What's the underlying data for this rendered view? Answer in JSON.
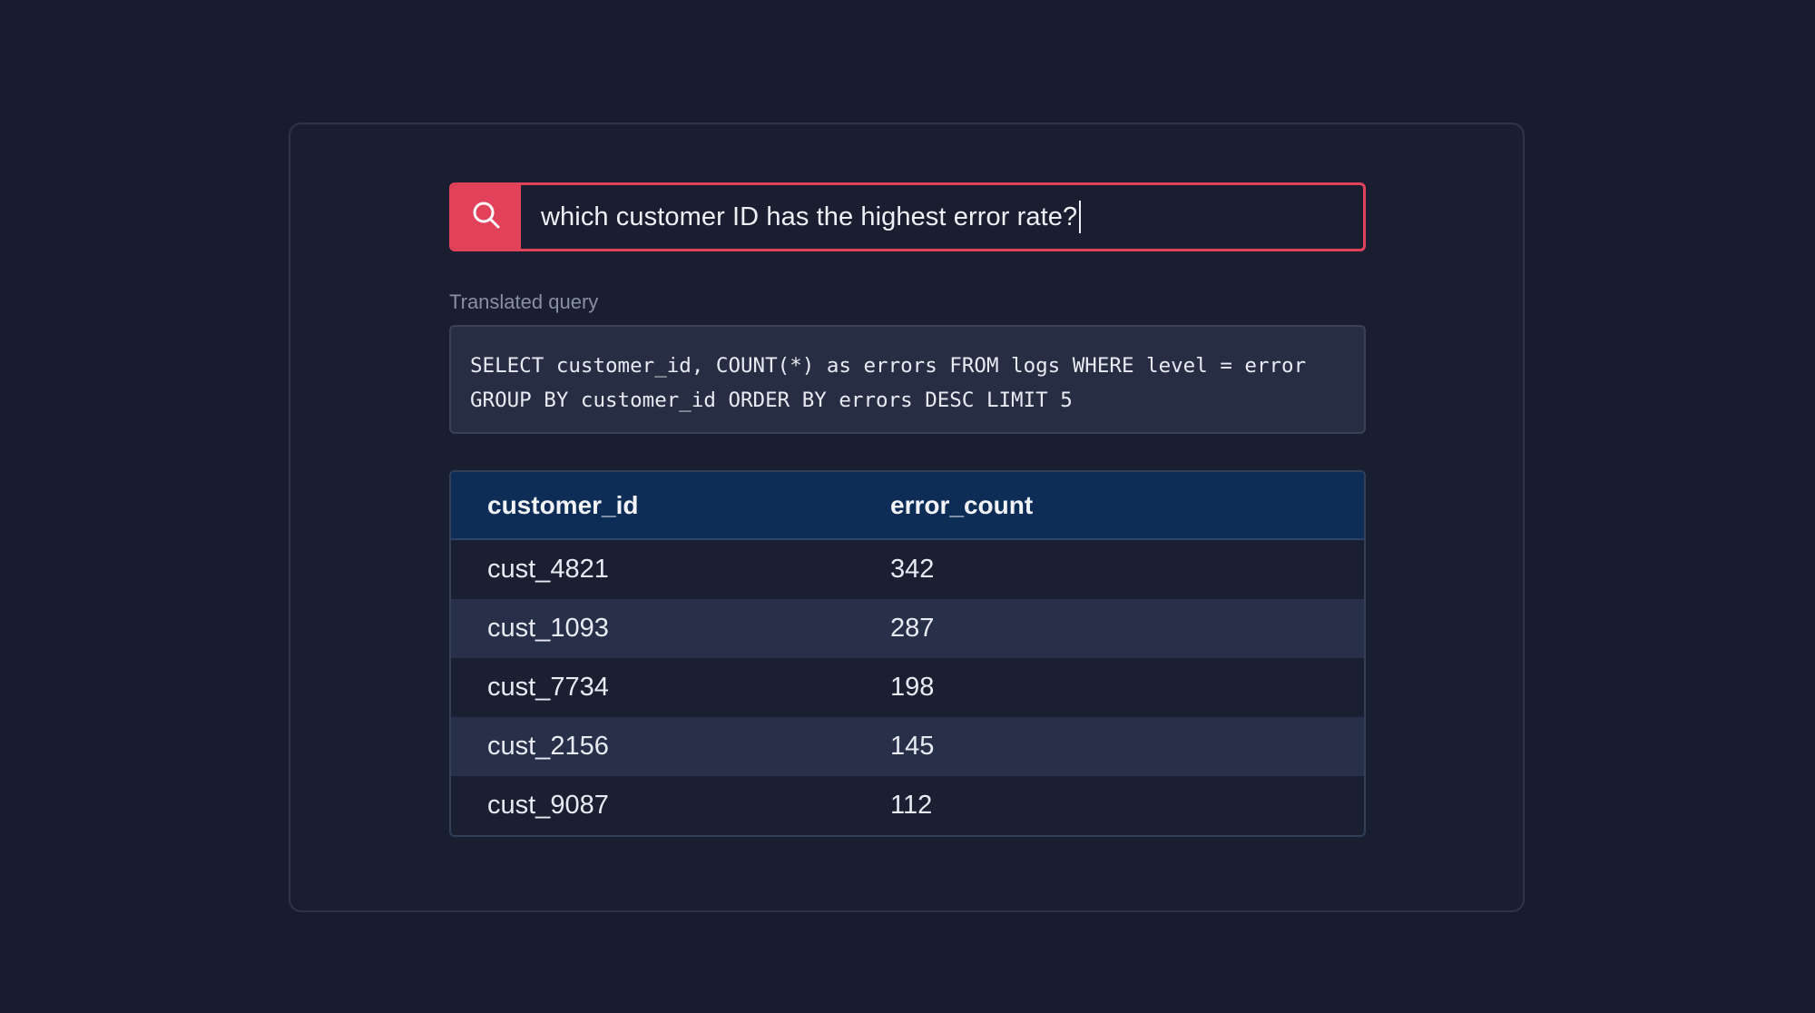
{
  "search": {
    "icon": "search-icon",
    "query": "which customer ID has the highest error rate?",
    "accent": "#e2415a"
  },
  "translated": {
    "label": "Translated query",
    "line1": "SELECT customer_id, COUNT(*) as errors FROM logs WHERE level = error",
    "line2": "GROUP BY customer_id ORDER BY errors DESC LIMIT 5"
  },
  "results": {
    "columns": [
      "customer_id",
      "error_count"
    ],
    "rows": [
      {
        "customer_id": "cust_4821",
        "error_count": "342"
      },
      {
        "customer_id": "cust_1093",
        "error_count": "287"
      },
      {
        "customer_id": "cust_7734",
        "error_count": "198"
      },
      {
        "customer_id": "cust_2156",
        "error_count": "145"
      },
      {
        "customer_id": "cust_9087",
        "error_count": "112"
      }
    ],
    "header_color": "#0d2d57"
  }
}
